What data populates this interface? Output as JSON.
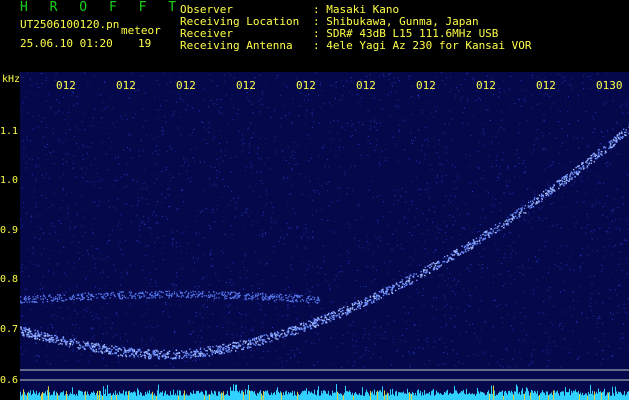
{
  "header": {
    "title": "H R O F F T",
    "filename": "UT2506100120.pn",
    "type": "meteor",
    "datetime": "25.06.10 01:20",
    "number": "19",
    "meta": [
      {
        "key": "Observer",
        "value": ": Masaki Kano"
      },
      {
        "key": "Receiving Location",
        "value": ": Shibukawa, Gunma, Japan"
      },
      {
        "key": "Receiver",
        "value": ": SDR# 43dB L15 111.6MHz USB"
      },
      {
        "key": "Receiving Antenna",
        "value": ": 4ele Yagi Az 230 for Kansai VOR"
      }
    ]
  },
  "axis": {
    "unit": "kHz",
    "y_ticks": [
      "1.1",
      "1.0",
      "0.9",
      "0.8",
      "0.7",
      "0.6"
    ],
    "x_ticks": [
      "012",
      "012",
      "012",
      "012",
      "012",
      "012",
      "012",
      "012",
      "012",
      "0130"
    ]
  },
  "colors": {
    "background": "#000000",
    "text": "#ffff4a",
    "title": "#19d319",
    "spectrum_bg": "#05084a",
    "signal": "#6a8cff",
    "noise_baseline": "#30d0ff"
  }
}
